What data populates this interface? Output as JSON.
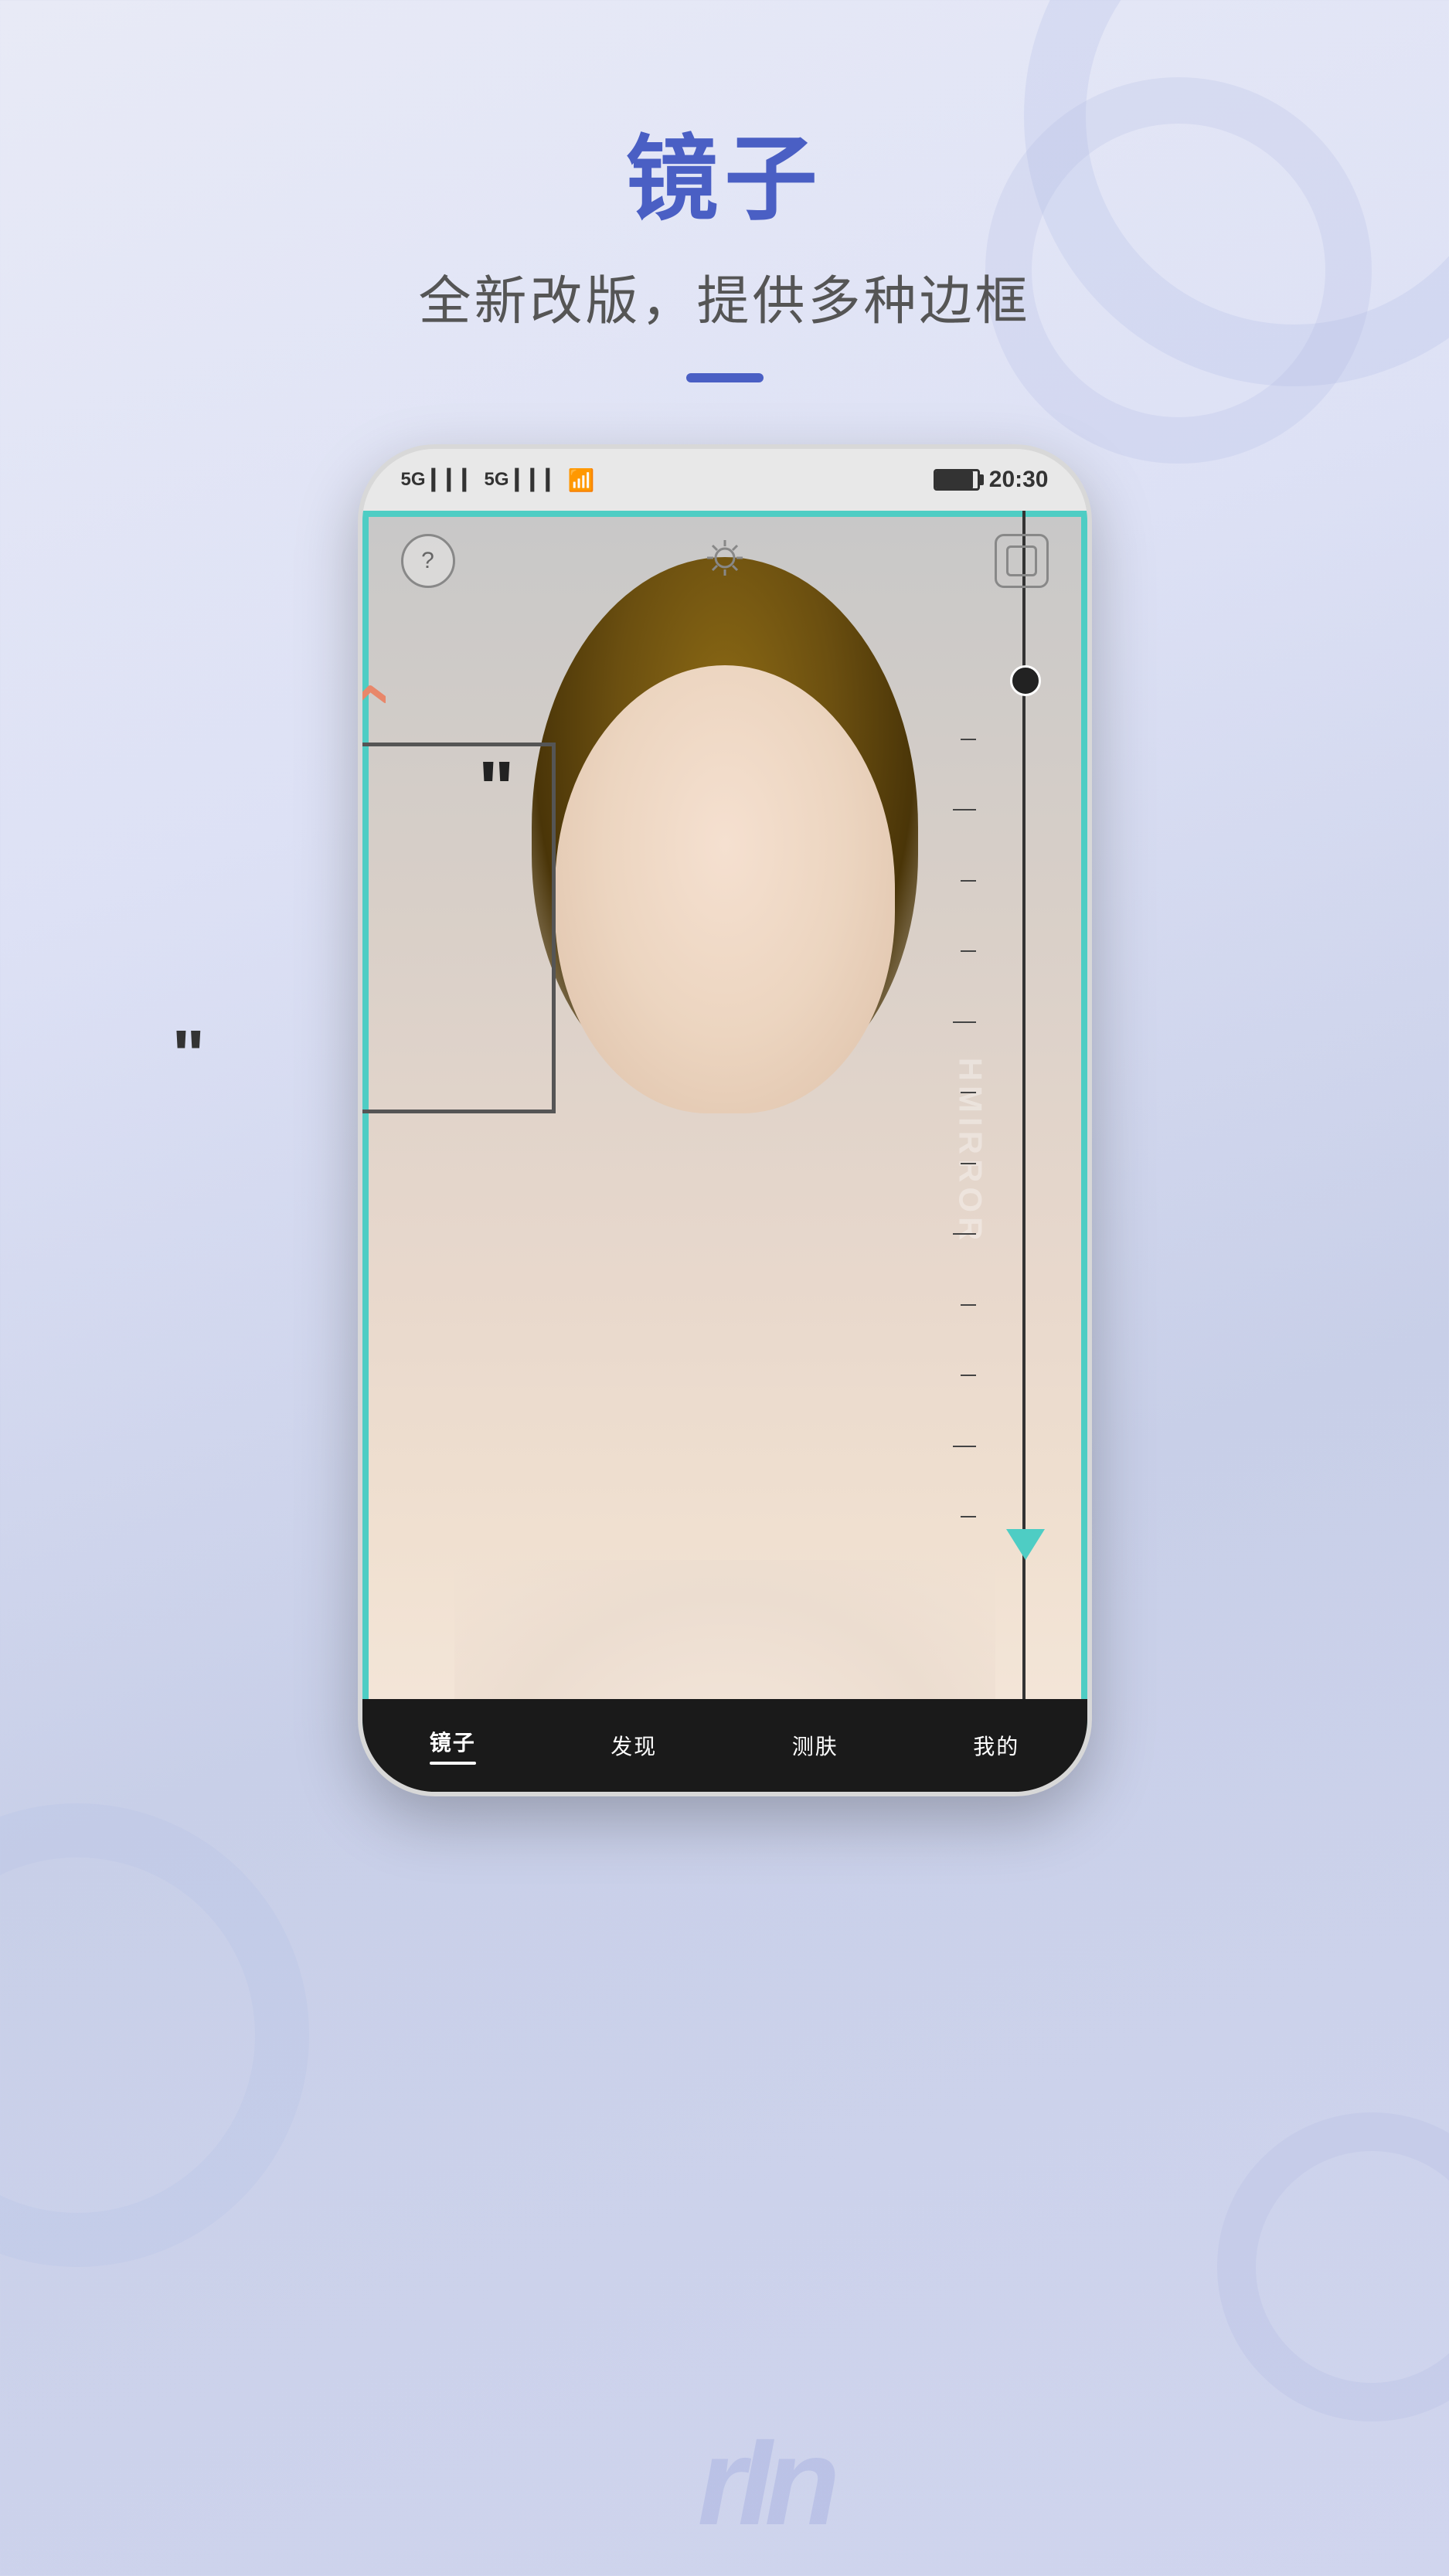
{
  "header": {
    "title": "镜子",
    "subtitle": "全新改版，提供多种边框",
    "divider_color": "#4a5fc4"
  },
  "status_bar": {
    "signal_left": "5G",
    "signal_right": "5G",
    "wifi": "WiFi",
    "time": "20:30"
  },
  "mirror_app": {
    "watermark": "HMIRROR",
    "quote_inside": "“",
    "quote_outside": "”"
  },
  "bottom_tabs": [
    {
      "label": "镜子",
      "active": true
    },
    {
      "label": "发现",
      "active": false
    },
    {
      "label": "测肤",
      "active": false
    },
    {
      "label": "我的",
      "active": false
    }
  ],
  "bottom_text": "rIn"
}
